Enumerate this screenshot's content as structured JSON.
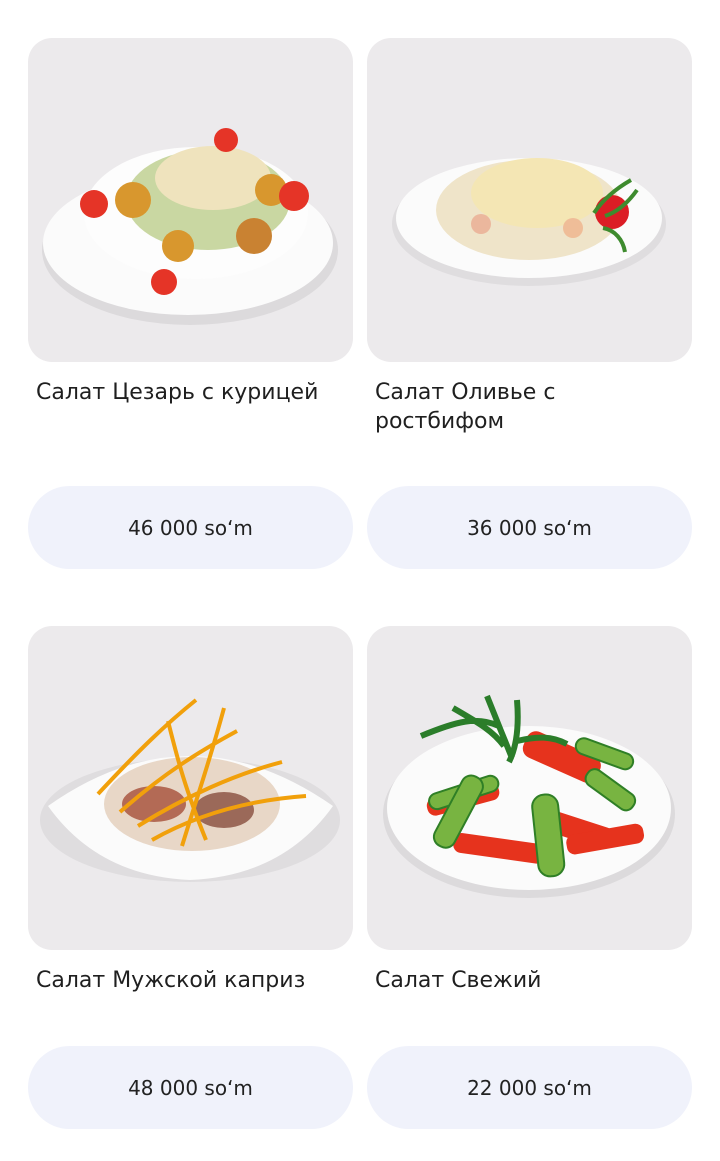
{
  "products": [
    {
      "name": "Салат Цезарь с курицей",
      "price": "46 000 so‘m",
      "image_icon": "caesar-salad-image"
    },
    {
      "name": "Салат Оливье с ростбифом",
      "price": "36 000 so‘m",
      "image_icon": "olivier-salad-image"
    },
    {
      "name": "Салат Мужской каприз",
      "price": "48 000 so‘m",
      "image_icon": "mens-caprice-salad-image"
    },
    {
      "name": "Салат Свежий",
      "price": "22 000 so‘m",
      "image_icon": "fresh-salad-image"
    }
  ],
  "colors": {
    "image_background": "#eceaec",
    "price_button_background": "#f0f2fb",
    "title_text": "#1f1f1f"
  }
}
